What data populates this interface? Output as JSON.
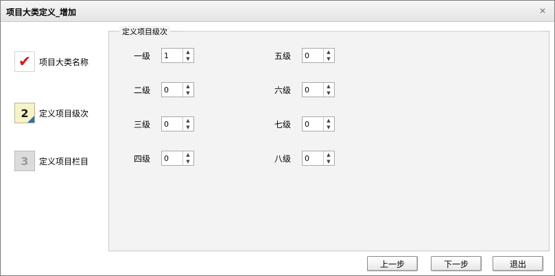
{
  "window": {
    "title": "项目大类定义_增加",
    "close_glyph": "✕"
  },
  "steps": [
    {
      "label": "项目大类名称",
      "state": "done",
      "icon": "✔"
    },
    {
      "label": "定义项目级次",
      "state": "current",
      "icon": "2"
    },
    {
      "label": "定义项目栏目",
      "state": "future",
      "icon": "3"
    }
  ],
  "group": {
    "title": "定义项目级次"
  },
  "levels": {
    "level1": {
      "label": "一级",
      "value": "1"
    },
    "level2": {
      "label": "二级",
      "value": "0"
    },
    "level3": {
      "label": "三级",
      "value": "0"
    },
    "level4": {
      "label": "四级",
      "value": "0"
    },
    "level5": {
      "label": "五级",
      "value": "0"
    },
    "level6": {
      "label": "六级",
      "value": "0"
    },
    "level7": {
      "label": "七级",
      "value": "0"
    },
    "level8": {
      "label": "八级",
      "value": "0"
    }
  },
  "spinner": {
    "up": "▲",
    "down": "▼"
  },
  "buttons": {
    "prev": "上一步",
    "next": "下一步",
    "exit": "退出"
  },
  "colors": {
    "done": "#d31a1a",
    "current_accent": "#2c6fb6",
    "panel_bg": "#f3f3f3"
  }
}
